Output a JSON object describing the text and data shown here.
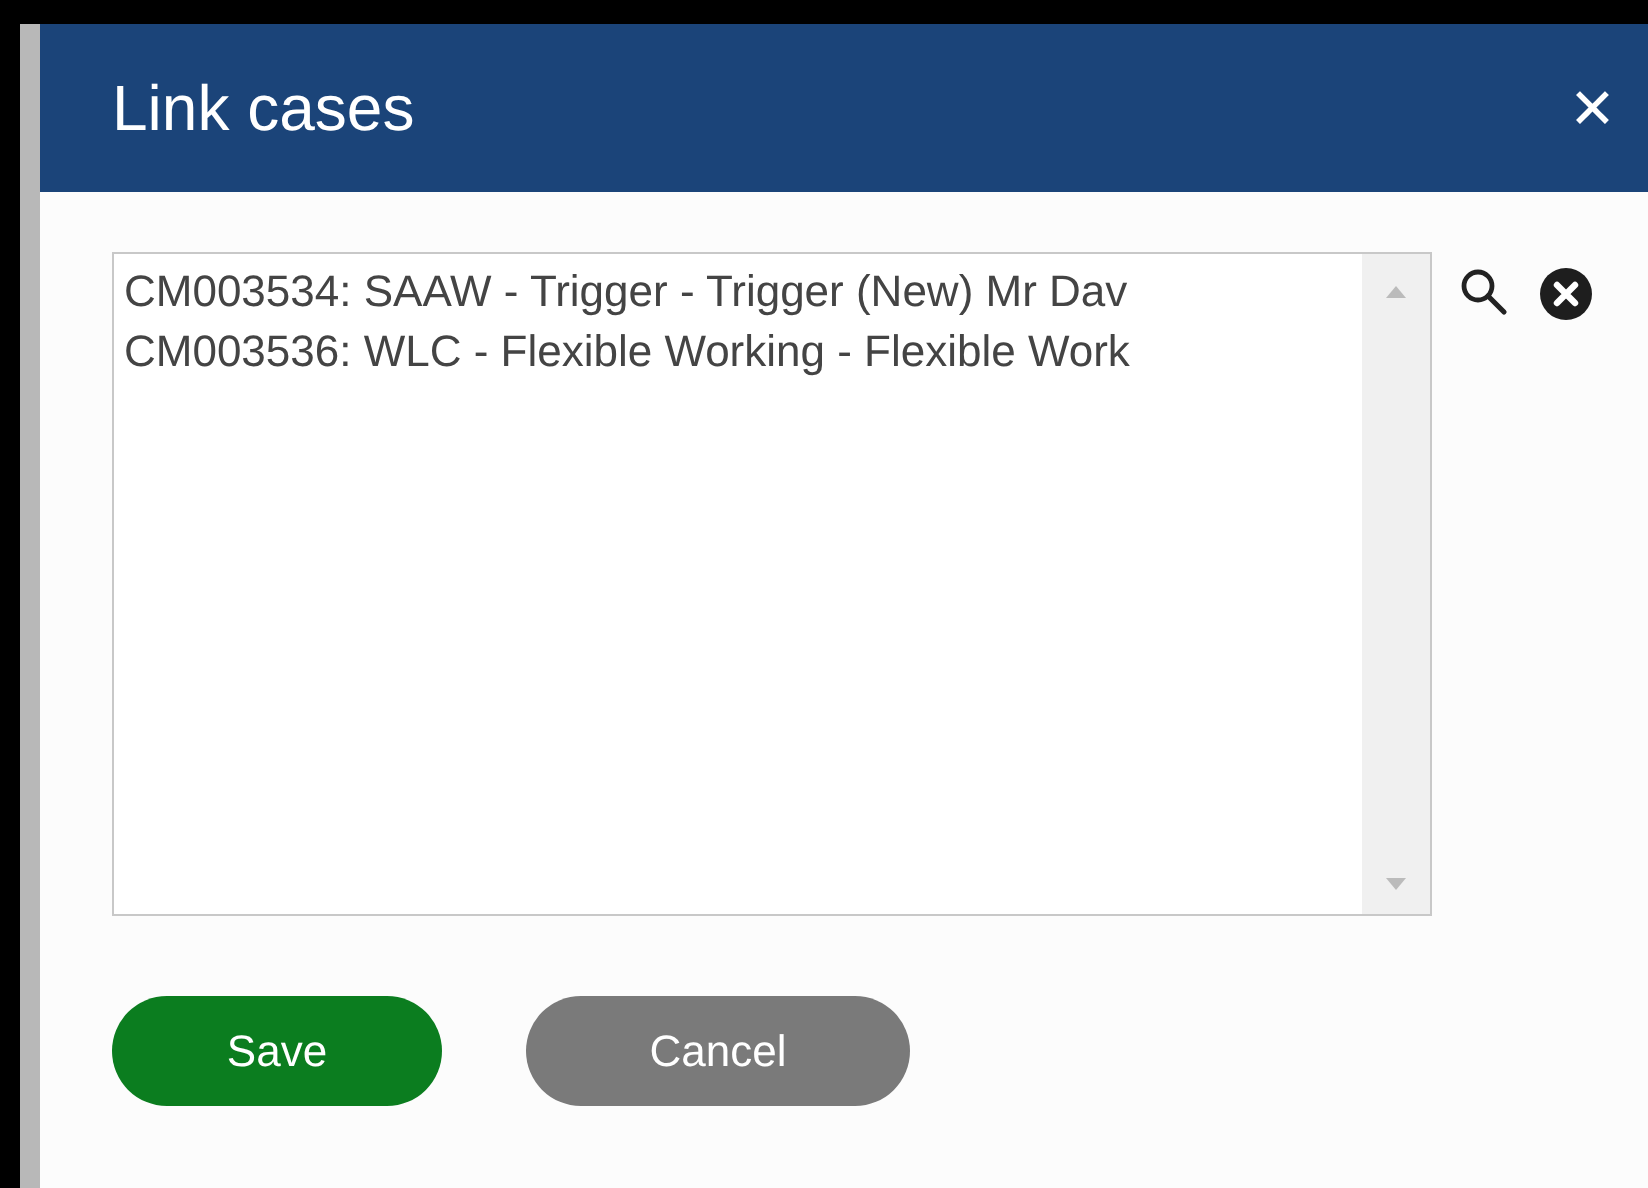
{
  "dialog": {
    "title": "Link cases",
    "close": "✕"
  },
  "linked_cases": {
    "items": [
      {
        "text": "CM003534: SAAW - Trigger - Trigger (New) Mr Dav"
      },
      {
        "text": "CM003536: WLC - Flexible Working - Flexible Work"
      }
    ]
  },
  "buttons": [
    {
      "label": "Save",
      "kind": "primary"
    },
    {
      "label": "Cancel",
      "kind": "secondary"
    }
  ]
}
